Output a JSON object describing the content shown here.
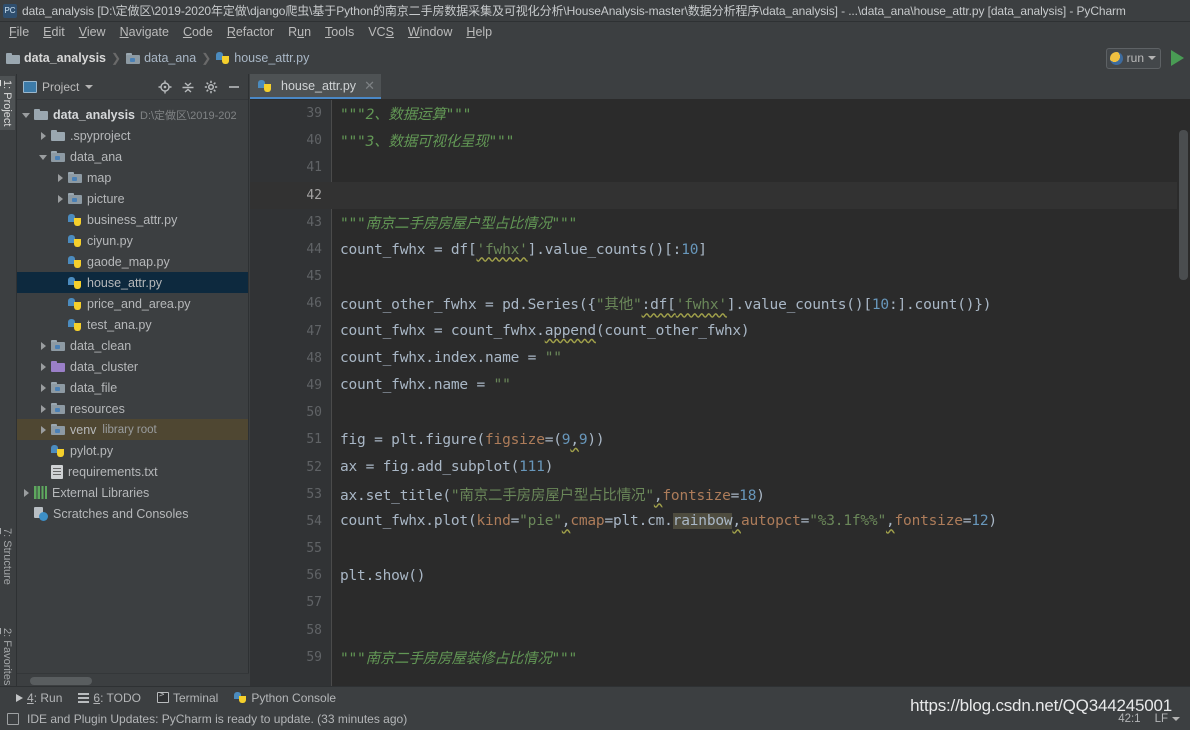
{
  "window": {
    "title": "data_analysis [D:\\定做区\\2019-2020年定做\\django爬虫\\基于Python的南京二手房数据采集及可视化分析\\HouseAnalysis-master\\数据分析程序\\data_analysis] - ...\\data_ana\\house_attr.py [data_analysis] - PyCharm",
    "app_icon": "pycharm-icon"
  },
  "menubar": {
    "items": [
      {
        "label": "File",
        "mnemonic": "F"
      },
      {
        "label": "Edit",
        "mnemonic": "E"
      },
      {
        "label": "View",
        "mnemonic": "V"
      },
      {
        "label": "Navigate",
        "mnemonic": "N"
      },
      {
        "label": "Code",
        "mnemonic": "C"
      },
      {
        "label": "Refactor",
        "mnemonic": "R"
      },
      {
        "label": "Run",
        "mnemonic": "u"
      },
      {
        "label": "Tools",
        "mnemonic": "T"
      },
      {
        "label": "VCS",
        "mnemonic": "S"
      },
      {
        "label": "Window",
        "mnemonic": "W"
      },
      {
        "label": "Help",
        "mnemonic": "H"
      }
    ]
  },
  "breadcrumb": {
    "items": [
      {
        "label": "data_analysis",
        "icon": "folder-icon"
      },
      {
        "label": "data_ana",
        "icon": "source-folder-icon"
      },
      {
        "label": "house_attr.py",
        "icon": "python-file-icon"
      }
    ],
    "separator": "❯"
  },
  "run_toolbar": {
    "config_name": "run",
    "config_icon": "run-config-icon",
    "dropdown_icon": "chevron-down-icon",
    "run_icon": "run-play-icon"
  },
  "left_tool_tabs": [
    {
      "label": "1: Project",
      "num": "1",
      "selected": true
    },
    {
      "label": "7: Structure",
      "num": "7",
      "selected": false
    },
    {
      "label": "2: Favorites",
      "num": "2",
      "selected": false
    }
  ],
  "project_panel": {
    "title": "Project",
    "dropdown_icon": "chevron-down-icon",
    "actions": [
      {
        "name": "locate-icon"
      },
      {
        "name": "collapse-all-icon"
      },
      {
        "name": "gear-icon"
      },
      {
        "name": "hide-icon"
      }
    ],
    "tree": [
      {
        "depth": 0,
        "arrow": "open",
        "icon": "folder-icon",
        "label": "data_analysis",
        "bold": true,
        "sub": "D:\\定做区\\2019-202",
        "note": "",
        "state": "none"
      },
      {
        "depth": 1,
        "arrow": "closed",
        "icon": "folder-icon",
        "label": ".spyproject",
        "bold": false,
        "sub": "",
        "note": "",
        "state": "none"
      },
      {
        "depth": 1,
        "arrow": "open",
        "icon": "source-folder-icon",
        "label": "data_ana",
        "bold": false,
        "sub": "",
        "note": "",
        "state": "none"
      },
      {
        "depth": 2,
        "arrow": "closed",
        "icon": "source-folder-icon",
        "label": "map",
        "bold": false,
        "sub": "",
        "note": "",
        "state": "none"
      },
      {
        "depth": 2,
        "arrow": "closed",
        "icon": "source-folder-icon",
        "label": "picture",
        "bold": false,
        "sub": "",
        "note": "",
        "state": "none"
      },
      {
        "depth": 2,
        "arrow": "none",
        "icon": "python-file-icon",
        "label": "business_attr.py",
        "bold": false,
        "sub": "",
        "note": "",
        "state": "none"
      },
      {
        "depth": 2,
        "arrow": "none",
        "icon": "python-file-icon",
        "label": "ciyun.py",
        "bold": false,
        "sub": "",
        "note": "",
        "state": "none"
      },
      {
        "depth": 2,
        "arrow": "none",
        "icon": "python-file-icon",
        "label": "gaode_map.py",
        "bold": false,
        "sub": "",
        "note": "",
        "state": "none"
      },
      {
        "depth": 2,
        "arrow": "none",
        "icon": "python-file-icon",
        "label": "house_attr.py",
        "bold": false,
        "sub": "",
        "note": "",
        "state": "selected"
      },
      {
        "depth": 2,
        "arrow": "none",
        "icon": "python-file-icon",
        "label": "price_and_area.py",
        "bold": false,
        "sub": "",
        "note": "",
        "state": "none"
      },
      {
        "depth": 2,
        "arrow": "none",
        "icon": "python-file-icon",
        "label": "test_ana.py",
        "bold": false,
        "sub": "",
        "note": "",
        "state": "none"
      },
      {
        "depth": 1,
        "arrow": "closed",
        "icon": "source-folder-icon",
        "label": "data_clean",
        "bold": false,
        "sub": "",
        "note": "",
        "state": "none"
      },
      {
        "depth": 1,
        "arrow": "closed",
        "icon": "purple-folder-icon",
        "label": "data_cluster",
        "bold": false,
        "sub": "",
        "note": "",
        "state": "none"
      },
      {
        "depth": 1,
        "arrow": "closed",
        "icon": "source-folder-icon",
        "label": "data_file",
        "bold": false,
        "sub": "",
        "note": "",
        "state": "none"
      },
      {
        "depth": 1,
        "arrow": "closed",
        "icon": "source-folder-icon",
        "label": "resources",
        "bold": false,
        "sub": "",
        "note": "",
        "state": "none"
      },
      {
        "depth": 1,
        "arrow": "closed",
        "icon": "source-folder-icon",
        "label": "venv",
        "bold": false,
        "sub": "",
        "note": "library root",
        "state": "venv-highlight"
      },
      {
        "depth": 1,
        "arrow": "none",
        "icon": "python-file-icon",
        "label": "pylot.py",
        "bold": false,
        "sub": "",
        "note": "",
        "state": "none"
      },
      {
        "depth": 1,
        "arrow": "none",
        "icon": "text-file-icon",
        "label": "requirements.txt",
        "bold": false,
        "sub": "",
        "note": "",
        "state": "none"
      },
      {
        "depth": 0,
        "arrow": "closed",
        "icon": "library-icon",
        "label": "External Libraries",
        "bold": false,
        "sub": "",
        "note": "",
        "state": "none"
      },
      {
        "depth": 0,
        "arrow": "none",
        "icon": "scratches-icon",
        "label": "Scratches and Consoles",
        "bold": false,
        "sub": "",
        "note": "",
        "state": "none"
      }
    ]
  },
  "editor": {
    "tabs": [
      {
        "label": "house_attr.py",
        "icon": "python-file-icon",
        "active": true,
        "close_icon": "close-icon"
      }
    ],
    "current_line": 42,
    "lines": [
      {
        "num": 39,
        "tokens": [
          {
            "t": "\"\"\"2、数据运算\"\"\"",
            "c": "s-doc"
          }
        ]
      },
      {
        "num": 40,
        "tokens": [
          {
            "t": "\"\"\"3、数据可视化呈现\"\"\"",
            "c": "s-doc"
          }
        ]
      },
      {
        "num": 41,
        "tokens": []
      },
      {
        "num": 42,
        "tokens": []
      },
      {
        "num": 43,
        "tokens": [
          {
            "t": "\"\"\"南京二手房房屋户型占比情况\"\"\"",
            "c": "s-doc"
          }
        ]
      },
      {
        "num": 44,
        "tokens": [
          {
            "t": "count_fwhx = df[",
            "c": "s-plain"
          },
          {
            "t": "'fwhx'",
            "c": "s-str s-err"
          },
          {
            "t": "].value_counts()[:",
            "c": "s-plain"
          },
          {
            "t": "10",
            "c": "s-num"
          },
          {
            "t": "]",
            "c": "s-plain"
          }
        ]
      },
      {
        "num": 45,
        "tokens": []
      },
      {
        "num": 46,
        "tokens": [
          {
            "t": "count_other_fwhx = pd.Series({",
            "c": "s-plain"
          },
          {
            "t": "\"其他\"",
            "c": "s-str"
          },
          {
            "t": ":df[",
            "c": "s-plain s-err"
          },
          {
            "t": "'fwhx'",
            "c": "s-str s-err"
          },
          {
            "t": "].value_counts()[",
            "c": "s-plain"
          },
          {
            "t": "10",
            "c": "s-num"
          },
          {
            "t": ":].count()})",
            "c": "s-plain"
          }
        ]
      },
      {
        "num": 47,
        "tokens": [
          {
            "t": "count_fwhx = count_fwhx.",
            "c": "s-plain"
          },
          {
            "t": "append",
            "c": "s-plain s-err"
          },
          {
            "t": "(count_other_fwhx)",
            "c": "s-plain"
          }
        ]
      },
      {
        "num": 48,
        "tokens": [
          {
            "t": "count_fwhx.index.name = ",
            "c": "s-plain"
          },
          {
            "t": "\"\"",
            "c": "s-str"
          }
        ]
      },
      {
        "num": 49,
        "tokens": [
          {
            "t": "count_fwhx.name = ",
            "c": "s-plain"
          },
          {
            "t": "\"\"",
            "c": "s-str"
          }
        ]
      },
      {
        "num": 50,
        "tokens": []
      },
      {
        "num": 51,
        "tokens": [
          {
            "t": "fig = plt.figure(",
            "c": "s-plain"
          },
          {
            "t": "figsize",
            "c": "s-kwa"
          },
          {
            "t": "=(",
            "c": "s-plain"
          },
          {
            "t": "9",
            "c": "s-num"
          },
          {
            "t": ",",
            "c": "s-plain s-err"
          },
          {
            "t": "9",
            "c": "s-num"
          },
          {
            "t": "))",
            "c": "s-plain"
          }
        ]
      },
      {
        "num": 52,
        "tokens": [
          {
            "t": "ax = fig.add_subplot(",
            "c": "s-plain"
          },
          {
            "t": "111",
            "c": "s-num"
          },
          {
            "t": ")",
            "c": "s-plain"
          }
        ]
      },
      {
        "num": 53,
        "tokens": [
          {
            "t": "ax.set_title(",
            "c": "s-plain"
          },
          {
            "t": "\"南京二手房房屋户型占比情况\"",
            "c": "s-str"
          },
          {
            "t": ",",
            "c": "s-plain s-err"
          },
          {
            "t": "fontsize",
            "c": "s-kwa"
          },
          {
            "t": "=",
            "c": "s-plain"
          },
          {
            "t": "18",
            "c": "s-num"
          },
          {
            "t": ")",
            "c": "s-plain"
          }
        ]
      },
      {
        "num": 54,
        "tokens": [
          {
            "t": "count_fwhx.plot(",
            "c": "s-plain"
          },
          {
            "t": "kind",
            "c": "s-kwa"
          },
          {
            "t": "=",
            "c": "s-plain"
          },
          {
            "t": "\"pie\"",
            "c": "s-str"
          },
          {
            "t": ",",
            "c": "s-plain s-err"
          },
          {
            "t": "cmap",
            "c": "s-kwa"
          },
          {
            "t": "=plt.cm.",
            "c": "s-plain"
          },
          {
            "t": "rainbow",
            "c": "s-plain s-hl"
          },
          {
            "t": ",",
            "c": "s-plain s-err"
          },
          {
            "t": "autopct",
            "c": "s-kwa"
          },
          {
            "t": "=",
            "c": "s-plain"
          },
          {
            "t": "\"%3.1f%%\"",
            "c": "s-str"
          },
          {
            "t": ",",
            "c": "s-plain s-err"
          },
          {
            "t": "fontsize",
            "c": "s-kwa"
          },
          {
            "t": "=",
            "c": "s-plain"
          },
          {
            "t": "12",
            "c": "s-num"
          },
          {
            "t": ")",
            "c": "s-plain"
          }
        ]
      },
      {
        "num": 55,
        "tokens": []
      },
      {
        "num": 56,
        "tokens": [
          {
            "t": "plt.show()",
            "c": "s-plain"
          }
        ]
      },
      {
        "num": 57,
        "tokens": []
      },
      {
        "num": 58,
        "tokens": []
      },
      {
        "num": 59,
        "tokens": [
          {
            "t": "\"\"\"南京二手房房屋装修占比情况\"\"\"",
            "c": "s-doc"
          }
        ]
      }
    ]
  },
  "tool_windows": [
    {
      "label": "4: Run",
      "num": "4",
      "icon": "run-triangle-icon"
    },
    {
      "label": "6: TODO",
      "num": "6",
      "icon": "todo-icon"
    },
    {
      "label": "Terminal",
      "num": "",
      "icon": "terminal-icon"
    },
    {
      "label": "Python Console",
      "num": "",
      "icon": "python-console-icon"
    }
  ],
  "statusbar": {
    "icon": "event-log-icon",
    "message": "IDE and Plugin Updates: PyCharm is ready to update. (33 minutes ago)",
    "caret_position": "42:1",
    "line_separator": "LF",
    "line_separator_caret": "chevron-down-icon"
  },
  "watermark": {
    "text": "https://blog.csdn.net/QQ344245001"
  },
  "colors": {
    "chrome_bg": "#3c3f41",
    "editor_bg": "#2b2b2b",
    "gutter_bg": "#313335",
    "selection_blue": "#0d293e",
    "venv_highlight": "#4f4732",
    "accent_blue": "#4a88c7",
    "run_green": "#499c54",
    "string_green": "#6a8759",
    "doc_green": "#629755",
    "number_blue": "#6897bb",
    "kwarg_orange": "#ad7c5a",
    "text_fg": "#a9b7c6"
  }
}
